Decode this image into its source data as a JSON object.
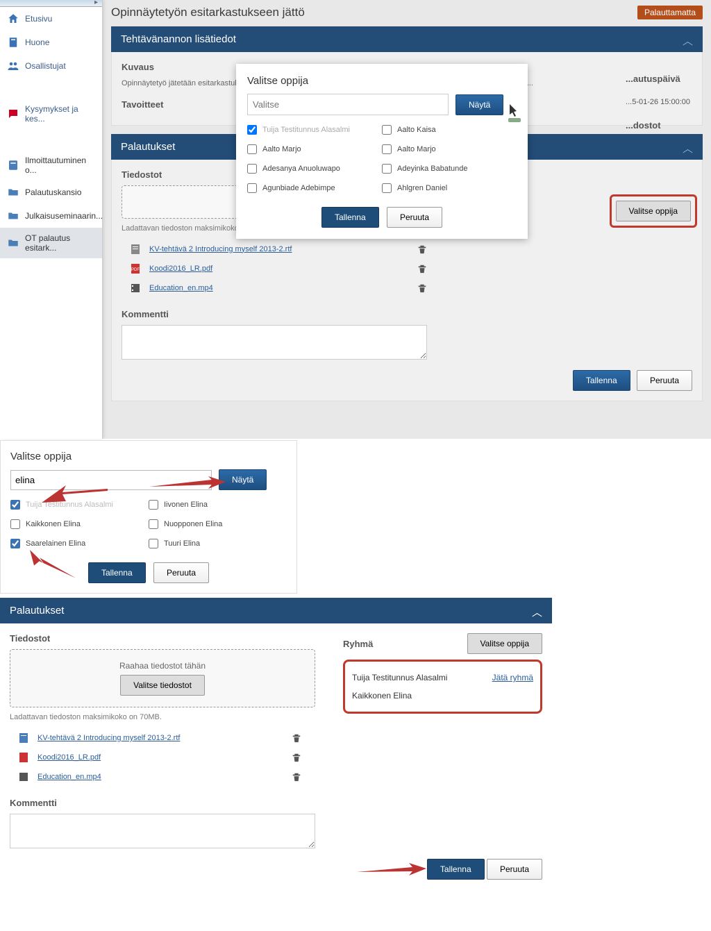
{
  "sidebar": {
    "items": [
      {
        "label": "Etusivu"
      },
      {
        "label": "Huone"
      },
      {
        "label": "Osallistujat"
      },
      {
        "label": "Kysymykset ja kes..."
      },
      {
        "label": "Ilmoittautuminen o..."
      },
      {
        "label": "Palautuskansio"
      },
      {
        "label": "Julkaisuseminaarin..."
      },
      {
        "label": "OT palautus esitark..."
      }
    ]
  },
  "page": {
    "title": "Opinnäytetyön esitarkastukseen jättö",
    "badge": "Palauttamatta"
  },
  "panel1": {
    "header": "Tehtävänannon lisätiedot",
    "kuvaus_label": "Kuvaus",
    "kuvaus_text": "Opinnäytetyö jätetään esitarkastukseen ... mennessä. Pari- tai ryhmäopinnäytety... opiskelija palauttaa työn ja merkitsee...",
    "tavoitteet_label": "Tavoitteet",
    "palautuspäivä_label": "...autuspäivä",
    "palautuspäivä_value": "...5-01-26 15:00:00",
    "dostot_label": "...dostot"
  },
  "modal": {
    "title": "Valitse oppija",
    "placeholder": "Valitse",
    "nayta": "Näytä",
    "students": [
      {
        "name": "Tuija Testitunnus Alasalmi",
        "checked": true
      },
      {
        "name": "Aalto Kaisa",
        "checked": false
      },
      {
        "name": "Aalto Marjo",
        "checked": false
      },
      {
        "name": "Aalto Marjo",
        "checked": false
      },
      {
        "name": "Adesanya Anuoluwapo",
        "checked": false
      },
      {
        "name": "Adeyinka Babatunde",
        "checked": false
      },
      {
        "name": "Agunbiade Adebimpe",
        "checked": false
      },
      {
        "name": "Ahlgren Daniel",
        "checked": false
      }
    ],
    "tallenna": "Tallenna",
    "peruuta": "Peruuta"
  },
  "palautukset": {
    "header": "Palautukset",
    "tiedostot_label": "Tiedostot",
    "raa_text": "Raa...",
    "valitse_oppija": "Valitse oppija",
    "maxsize": "Ladattavan tiedoston maksimikoko on 70MB.",
    "files": [
      {
        "name": "KV-tehtävä 2 Introducing myself 2013-2.rtf",
        "type": "doc"
      },
      {
        "name": "Koodi2016_LR.pdf",
        "type": "pdf"
      },
      {
        "name": "Education_en.mp4",
        "type": "video"
      }
    ],
    "kommentti_label": "Kommentti",
    "tallenna": "Tallenna",
    "peruuta": "Peruuta"
  },
  "section2": {
    "title": "Valitse oppija",
    "search_value": "elina",
    "nayta": "Näytä",
    "students": [
      {
        "name": "Tuija Testitunnus Alasalmi",
        "checked": true,
        "dim": true
      },
      {
        "name": "Iivonen Elina",
        "checked": false
      },
      {
        "name": "Kaikkonen Elina",
        "checked": false
      },
      {
        "name": "Nuopponen Elina",
        "checked": false
      },
      {
        "name": "Saarelainen Elina",
        "checked": true
      },
      {
        "name": "Tuuri Elina",
        "checked": false
      }
    ],
    "tallenna": "Tallenna",
    "peruuta": "Peruuta"
  },
  "section3": {
    "header": "Palautukset",
    "tiedostot_label": "Tiedostot",
    "drop_text": "Raahaa tiedostot tähän",
    "select_files": "Valitse tiedostot",
    "maxsize": "Ladattavan tiedoston maksimikoko on 70MB.",
    "ryhma_label": "Ryhmä",
    "valitse_oppija": "Valitse oppija",
    "group_members": [
      {
        "name": "Tuija Testitunnus Alasalmi"
      },
      {
        "name": "Kaikkonen Elina"
      }
    ],
    "leave": "Jätä ryhmä",
    "files": [
      {
        "name": "KV-tehtävä 2 Introducing myself 2013-2.rtf"
      },
      {
        "name": "Koodi2016_LR.pdf"
      },
      {
        "name": "Education_en.mp4"
      }
    ],
    "kommentti_label": "Kommentti",
    "tallenna": "Tallenna",
    "peruuta": "Peruuta"
  }
}
